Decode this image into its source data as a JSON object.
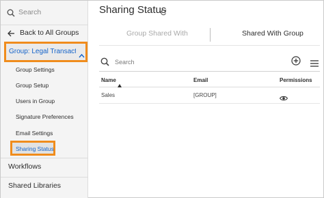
{
  "sidebar": {
    "search_placeholder": "Search",
    "back_label": "Back to All Groups",
    "group_label": "Group: Legal Transacti...",
    "items": [
      {
        "label": "Group Settings"
      },
      {
        "label": "Group Setup"
      },
      {
        "label": "Users in Group"
      },
      {
        "label": "Signature Preferences"
      },
      {
        "label": "Email Settings"
      },
      {
        "label": "Sharing Status"
      }
    ],
    "workflows_label": "Workflows",
    "shared_libraries_label": "Shared Libraries"
  },
  "main": {
    "title": "Sharing Status",
    "tabs": [
      {
        "label": "Group Shared With"
      },
      {
        "label": "Shared With Group"
      }
    ],
    "search_placeholder": "Search",
    "table": {
      "headers": {
        "name": "Name",
        "email": "Email",
        "permissions": "Permissions"
      },
      "rows": [
        {
          "name": "Sales",
          "email": "[GROUP]",
          "permission_icon": "eye-icon"
        }
      ]
    }
  },
  "colors": {
    "highlight_border": "#f08c1c",
    "link_blue": "#1463c9",
    "sidebar_bg": "#f4f4f4"
  }
}
